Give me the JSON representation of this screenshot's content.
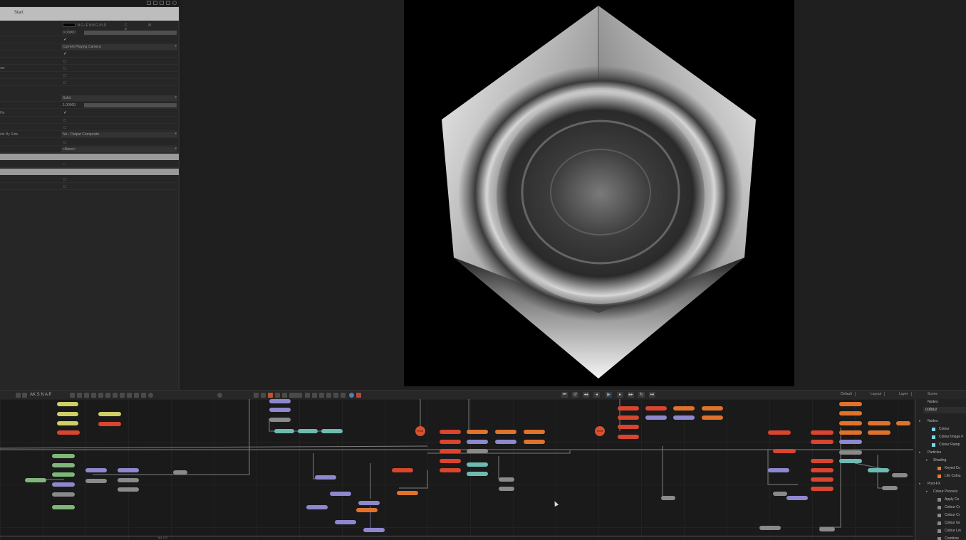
{
  "properties": {
    "header_label": "Start",
    "colour_swatch_label": "BG/ENBG/ND",
    "channel_toggles": "C M P",
    "rows": [
      {
        "label": "",
        "value": "0.00000"
      },
      {
        "label": "",
        "value": ""
      },
      {
        "label": "",
        "value": "Current Playing Camera"
      },
      {
        "label": "",
        "value": ""
      },
      {
        "label": "",
        "value": ""
      },
      {
        "label": "ser",
        "value": ""
      },
      {
        "label": "",
        "value": ""
      },
      {
        "label": "",
        "value": ""
      },
      {
        "label": "",
        "value": "Solid"
      },
      {
        "label": "",
        "value": "1.00000"
      },
      {
        "label": "Fix",
        "value": ""
      },
      {
        "label": "",
        "value": ""
      },
      {
        "label": "",
        "value": ""
      },
      {
        "label": "ide By Side",
        "value": "No - Output Composite"
      },
      {
        "label": "",
        "value": ""
      },
      {
        "label": "",
        "value": "<None>"
      },
      {
        "label": "",
        "value": ""
      },
      {
        "label": "",
        "value": ""
      },
      {
        "label": "",
        "value": ""
      }
    ]
  },
  "toolbar": {
    "tools_text": "AK S N A P",
    "transport_icons": [
      "skip-start-icon",
      "rewind-icon",
      "step-back-icon",
      "back-icon",
      "play-icon",
      "forward-icon",
      "step-forward-icon",
      "loop-icon",
      "skip-end-icon"
    ],
    "tabs": [
      "Default",
      "Layout",
      "Layer",
      "Nodes",
      "Scene"
    ]
  },
  "graph": {
    "hub_labels": [
      "Emit",
      "Emit"
    ],
    "fps_text": "fps 120"
  },
  "browser": {
    "tab_label": "Nodes",
    "search_value": "colour",
    "items": [
      {
        "label": "Nodes",
        "indent": 0,
        "arrow": "▸",
        "color": ""
      },
      {
        "label": "Colour",
        "indent": 2,
        "arrow": "",
        "color": "#7fd3e6"
      },
      {
        "label": "Colour Image F",
        "indent": 2,
        "arrow": "",
        "color": "#7fd3e6"
      },
      {
        "label": "Colour Ramp",
        "indent": 2,
        "arrow": "",
        "color": "#7fd3e6"
      },
      {
        "label": "Particles",
        "indent": 0,
        "arrow": "▸",
        "color": ""
      },
      {
        "label": "Shading",
        "indent": 1,
        "arrow": "▸",
        "color": ""
      },
      {
        "label": "Keyed Co",
        "indent": 3,
        "arrow": "",
        "color": "#e87b34"
      },
      {
        "label": "Life Colou",
        "indent": 3,
        "arrow": "",
        "color": "#e87b34"
      },
      {
        "label": "Post-FX",
        "indent": 0,
        "arrow": "▸",
        "color": ""
      },
      {
        "label": "Colour Process",
        "indent": 1,
        "arrow": "▸",
        "color": ""
      },
      {
        "label": "Apply Co",
        "indent": 3,
        "arrow": "",
        "color": "#8a8a8a"
      },
      {
        "label": "Colour Cr",
        "indent": 3,
        "arrow": "",
        "color": "#8a8a8a"
      },
      {
        "label": "Colour Cr",
        "indent": 3,
        "arrow": "",
        "color": "#8a8a8a"
      },
      {
        "label": "Colour Gr",
        "indent": 3,
        "arrow": "",
        "color": "#8a8a8a"
      },
      {
        "label": "Colour Lin",
        "indent": 3,
        "arrow": "",
        "color": "#8a8a8a"
      },
      {
        "label": "Combine",
        "indent": 3,
        "arrow": "",
        "color": "#8a8a8a"
      }
    ]
  },
  "colors": {
    "accent_blue": "#6fb3e8",
    "node_orange": "#e0732c",
    "node_red": "#d9452e",
    "node_yellow": "#cfcf66",
    "node_green": "#7fb77a",
    "node_teal": "#6fbab3",
    "node_violet": "#8e88cf",
    "node_grey": "#8a8a8a"
  }
}
